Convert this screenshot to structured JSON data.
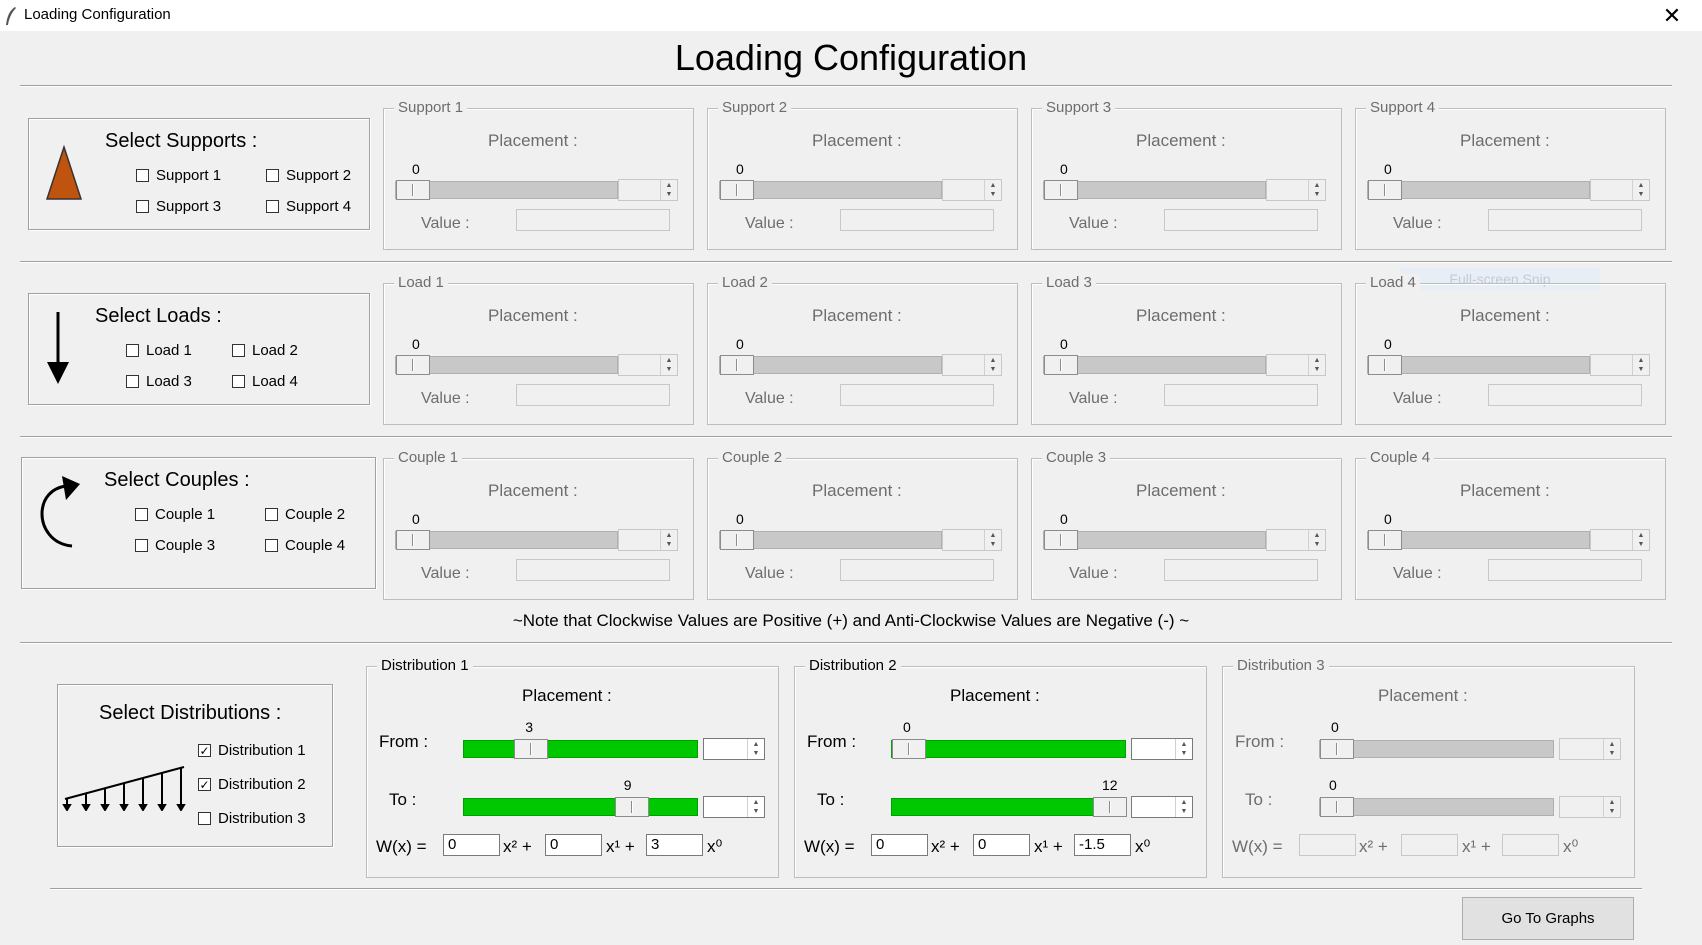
{
  "window": {
    "title": "Loading Configuration",
    "close_glyph": "✕"
  },
  "page_title": "Loading Configuration",
  "supports": {
    "title": "Select Supports :",
    "checks": [
      "Support 1",
      "Support 2",
      "Support 3",
      "Support 4"
    ],
    "icon_color": "#c0540f",
    "groups": [
      {
        "label": "Support 1",
        "placement": "Placement :",
        "value": "0",
        "value_label": "Value :"
      },
      {
        "label": "Support 2",
        "placement": "Placement :",
        "value": "0",
        "value_label": "Value :"
      },
      {
        "label": "Support 3",
        "placement": "Placement :",
        "value": "0",
        "value_label": "Value :"
      },
      {
        "label": "Support 4",
        "placement": "Placement :",
        "value": "0",
        "value_label": "Value :"
      }
    ]
  },
  "loads": {
    "title": "Select Loads :",
    "checks": [
      "Load 1",
      "Load 2",
      "Load 3",
      "Load 4"
    ],
    "groups": [
      {
        "label": "Load 1",
        "placement": "Placement :",
        "value": "0",
        "value_label": "Value :"
      },
      {
        "label": "Load 2",
        "placement": "Placement :",
        "value": "0",
        "value_label": "Value :"
      },
      {
        "label": "Load 3",
        "placement": "Placement :",
        "value": "0",
        "value_label": "Value :"
      },
      {
        "label": "Load 4",
        "placement": "Placement :",
        "value": "0",
        "value_label": "Value :"
      }
    ]
  },
  "couples": {
    "title": "Select Couples :",
    "checks": [
      "Couple 1",
      "Couple 2",
      "Couple 3",
      "Couple 4"
    ],
    "groups": [
      {
        "label": "Couple 1",
        "placement": "Placement :",
        "value": "0",
        "value_label": "Value :"
      },
      {
        "label": "Couple 2",
        "placement": "Placement :",
        "value": "0",
        "value_label": "Value :"
      },
      {
        "label": "Couple 3",
        "placement": "Placement :",
        "value": "0",
        "value_label": "Value :"
      },
      {
        "label": "Couple 4",
        "placement": "Placement :",
        "value": "0",
        "value_label": "Value :"
      }
    ]
  },
  "note": "~Note that Clockwise Values are Positive (+) and Anti-Clockwise Values are Negative (-) ~",
  "distributions": {
    "title": "Select Distributions :",
    "checks": [
      {
        "label": "Distribution 1",
        "checked": true
      },
      {
        "label": "Distribution 2",
        "checked": true
      },
      {
        "label": "Distribution 3",
        "checked": false
      }
    ],
    "check_mark": "✓",
    "groups": [
      {
        "label": "Distribution 1",
        "placement": "Placement :",
        "from_label": "From :",
        "to_label": "To :",
        "from_value": "3",
        "to_value": "9",
        "w_label": "W(x) =",
        "x2": "x² +",
        "x1": "x¹ +",
        "x0": "x⁰",
        "c2": "0",
        "c1": "0",
        "c0": "3",
        "enabled": true
      },
      {
        "label": "Distribution 2",
        "placement": "Placement :",
        "from_label": "From :",
        "to_label": "To :",
        "from_value": "0",
        "to_value": "12",
        "w_label": "W(x) =",
        "x2": "x² +",
        "x1": "x¹ +",
        "x0": "x⁰",
        "c2": "0",
        "c1": "0",
        "c0": "-1.5",
        "enabled": true
      },
      {
        "label": "Distribution 3",
        "placement": "Placement :",
        "from_label": "From :",
        "to_label": "To :",
        "from_value": "0",
        "to_value": "0",
        "w_label": "W(x) =",
        "x2": "x² +",
        "x1": "x¹ +",
        "x0": "x⁰",
        "c2": "",
        "c1": "",
        "c0": "",
        "enabled": false
      }
    ]
  },
  "go_button": "Go To Graphs",
  "snip_overlay": "Full-screen Snip"
}
